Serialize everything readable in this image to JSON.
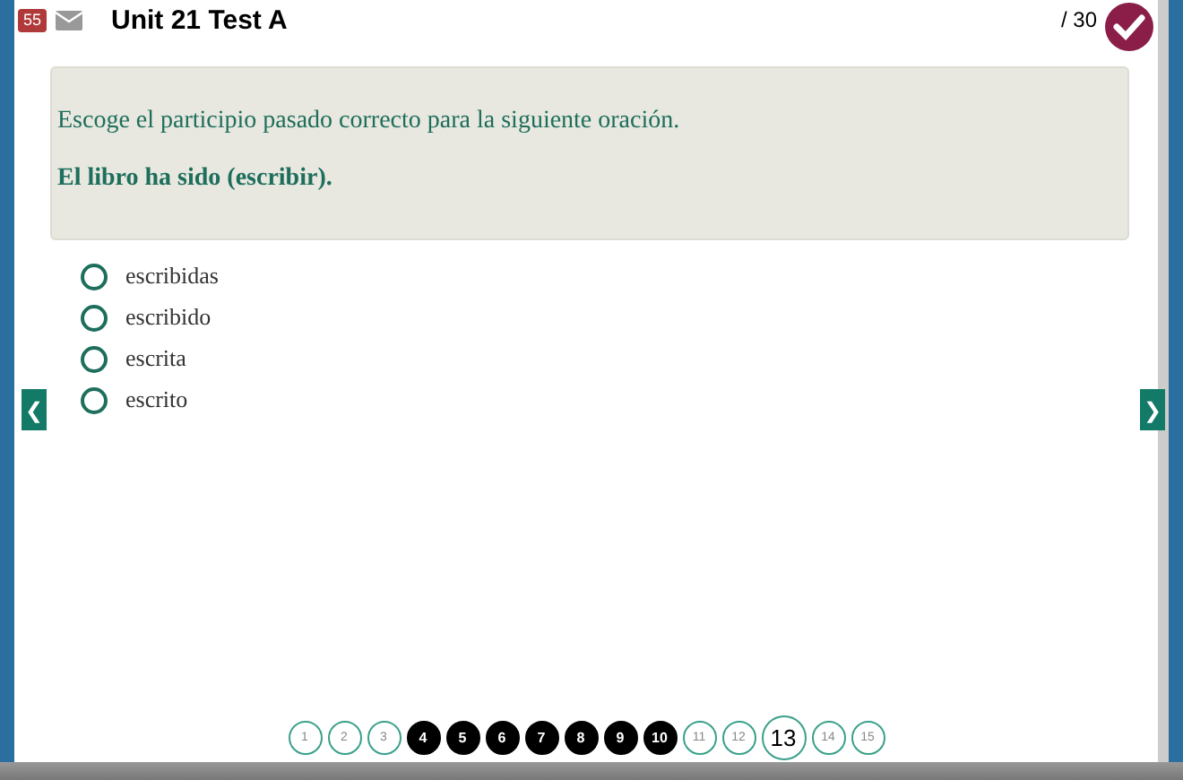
{
  "header": {
    "badge": "55",
    "title": "Unit 21 Test A",
    "score": "/ 30"
  },
  "question": {
    "instruction": "Escoge el participio pasado correcto para la siguiente oración.",
    "prompt": "El libro ha sido (escribir)."
  },
  "options": [
    {
      "label": "escribidas",
      "selected": false
    },
    {
      "label": "escribido",
      "selected": false
    },
    {
      "label": "escrita",
      "selected": false
    },
    {
      "label": "escrito",
      "selected": false
    }
  ],
  "nav": {
    "prev": "❮",
    "next": "❯"
  },
  "pages": [
    {
      "label": "1",
      "answered": false,
      "selected": false
    },
    {
      "label": "2",
      "answered": false,
      "selected": false
    },
    {
      "label": "3",
      "answered": false,
      "selected": false
    },
    {
      "label": "4",
      "answered": true,
      "selected": false
    },
    {
      "label": "5",
      "answered": true,
      "selected": false
    },
    {
      "label": "6",
      "answered": true,
      "selected": false
    },
    {
      "label": "7",
      "answered": true,
      "selected": false
    },
    {
      "label": "8",
      "answered": true,
      "selected": false
    },
    {
      "label": "9",
      "answered": true,
      "selected": false
    },
    {
      "label": "10",
      "answered": true,
      "selected": false
    },
    {
      "label": "11",
      "answered": false,
      "selected": false
    },
    {
      "label": "12",
      "answered": false,
      "selected": false
    },
    {
      "label": "13",
      "answered": false,
      "selected": true
    },
    {
      "label": "14",
      "answered": false,
      "selected": false
    },
    {
      "label": "15",
      "answered": false,
      "selected": false
    }
  ]
}
